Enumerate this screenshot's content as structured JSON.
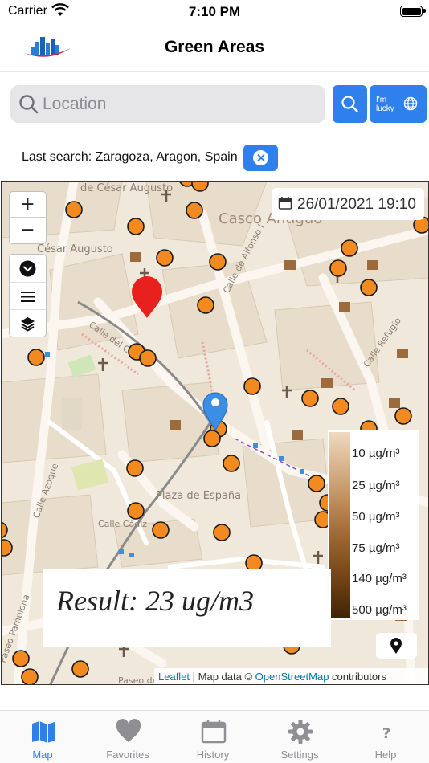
{
  "status_bar": {
    "carrier": "Carrier",
    "time": "7:10 PM"
  },
  "nav": {
    "title": "Green Areas",
    "logo_icon": "city-skyline-logo"
  },
  "search": {
    "placeholder": "Location",
    "search_icon": "search-icon",
    "lucky_label": "I'm lucky",
    "lucky_icon": "globe-icon"
  },
  "last_search": {
    "text": "Last search: Zaragoza, Aragon, Spain",
    "clear_icon": "clear-icon"
  },
  "map": {
    "controls": {
      "zoom_in": "+",
      "zoom_out": "−",
      "tools": [
        "chevron-down-icon",
        "menu-icon",
        "layers-icon"
      ]
    },
    "date": {
      "icon": "calendar-icon",
      "value": "26/01/2021 19:10"
    },
    "labels": [
      "de César Augusto",
      "Casco Antiguo",
      "César Augusto",
      "Calle de Alfonso I",
      "Calle Refugio",
      "Calle del Coso",
      "Calle Azoque",
      "Plaza de España",
      "Calle Cádiz",
      "Paseo del",
      "Paseo Pamplona"
    ],
    "legend": {
      "labels": [
        "10 µg/m³",
        "25 µg/m³",
        "50 µg/m³",
        "75 µg/m³",
        "140 µg/m³",
        "500 µg/m³"
      ],
      "gradient_colors": [
        "#efd9bf",
        "#d9b48e",
        "#b98755",
        "#94612d",
        "#6e4215",
        "#402305"
      ]
    },
    "result": "Result: 23 ug/m3",
    "locate_icon": "location-pin-icon",
    "attribution": {
      "leaflet": "Leaflet",
      "separator": " | Map data © ",
      "osm": "OpenStreetMap",
      "suffix": " contributors"
    },
    "marker_colors": {
      "station": "#f28a1f",
      "search_pin": "#e8201e",
      "user_pin": "#3a8ee6"
    }
  },
  "tabs": [
    {
      "label": "Map",
      "icon": "map-icon",
      "active": true
    },
    {
      "label": "Favorites",
      "icon": "heart-icon",
      "active": false
    },
    {
      "label": "History",
      "icon": "calendar-icon",
      "active": false
    },
    {
      "label": "Settings",
      "icon": "gear-icon",
      "active": false
    },
    {
      "label": "Help",
      "icon": "question-icon",
      "active": false
    }
  ],
  "colors": {
    "accent": "#2f80ed",
    "inactive": "#8e8e93"
  }
}
